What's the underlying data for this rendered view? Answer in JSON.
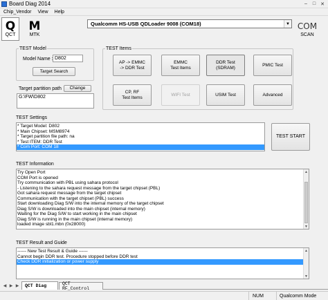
{
  "window": {
    "title": "Board Diag 2014"
  },
  "menu": [
    "Chip_Vendor",
    "View",
    "Help"
  ],
  "toolbar": {
    "qct": {
      "big": "Q",
      "small": "QCT"
    },
    "mtk": {
      "big": "M",
      "small": "MTK"
    },
    "com_scan": {
      "big": "COM",
      "small": "SCAN"
    }
  },
  "port": {
    "selected": "Qualcomm HS-USB QDLoader 9008 (COM18)"
  },
  "test_model": {
    "legend": "TEST Model",
    "model_name_label": "Model Name :",
    "model_name_value": "D802",
    "search_button": "Target Search"
  },
  "partition": {
    "label": "Target partition path",
    "change_button": "Change",
    "path": "G:\\FW\\D802"
  },
  "test_items": {
    "legend": "TEST Items",
    "buttons": [
      "AP -> EMMC\n-> DDR Test",
      "EMMC\nTest Items",
      "DDR Test\n(SDRAM)",
      "PMIC Test",
      "CP, RF\nTest Items",
      "WIFI Test",
      "USIM Test",
      "Advanced"
    ]
  },
  "test_settings": {
    "label": "TEST Settings",
    "lines": [
      "* Target Model: D802",
      "* Main Chipset: MSM8974",
      "* Target partition file path: na",
      "* Test ITEM: DDR Test",
      "* Com Port: COM 18"
    ],
    "start_button": "TEST START"
  },
  "test_information": {
    "label": "TEST Information",
    "lines": [
      "Try Open Port",
      "COM Port is opened",
      "Try communication with PBL using sahara protocol",
      " - Listening to the sahara request message from the target chipset (PBL)",
      "Got sahara request message from the target chipset",
      "Communication with the target chipset (PBL) success",
      "Start downloading Diag S/W into the internal memory of the target chipset",
      "Diag S/W is downloaded into the main chipset (internal memory)",
      "Waiting for the Diag S/W to start working in the main chipset",
      "Diag S/W is running in the main chipset (internal memory)",
      "loaded image sbl1.mbn (0x28000)"
    ]
  },
  "test_result": {
    "label": "TEST Result and Guide",
    "lines": [
      "------ New Test Result & Guide ------",
      "Cannot begin DDR test. Procedure stopped before DDR test",
      "Check DDR initialization or power supply"
    ]
  },
  "tabs": [
    "QCT Diag",
    "QCT RF_Control"
  ],
  "status": {
    "num": "NUM",
    "vendor": "Qualcomm Mode"
  },
  "colors": {
    "selection": "#3399ff",
    "window_bg": "#f0f0f0"
  }
}
